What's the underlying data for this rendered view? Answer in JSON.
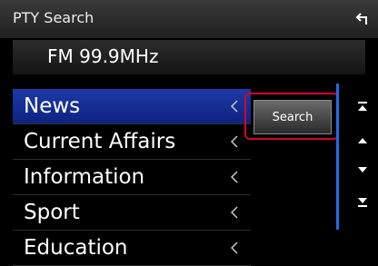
{
  "header": {
    "title": "PTY Search",
    "back_icon": "back-arrow-icon"
  },
  "frequency": "FM 99.9MHz",
  "list": {
    "items": [
      {
        "label": "News",
        "selected": true
      },
      {
        "label": "Current Affairs",
        "selected": false
      },
      {
        "label": "Information",
        "selected": false
      },
      {
        "label": "Sport",
        "selected": false
      },
      {
        "label": "Education",
        "selected": false
      }
    ],
    "arrow_icon": "chevron-left-icon"
  },
  "search_button": "Search",
  "scroll": {
    "buttons": [
      "scroll-top-icon",
      "scroll-up-icon",
      "scroll-down-icon",
      "scroll-bottom-icon"
    ]
  },
  "colors": {
    "selected_bg": "#1e3aa8",
    "highlight_outline": "#d8002a",
    "scroll_track": "#1d6cf0"
  }
}
